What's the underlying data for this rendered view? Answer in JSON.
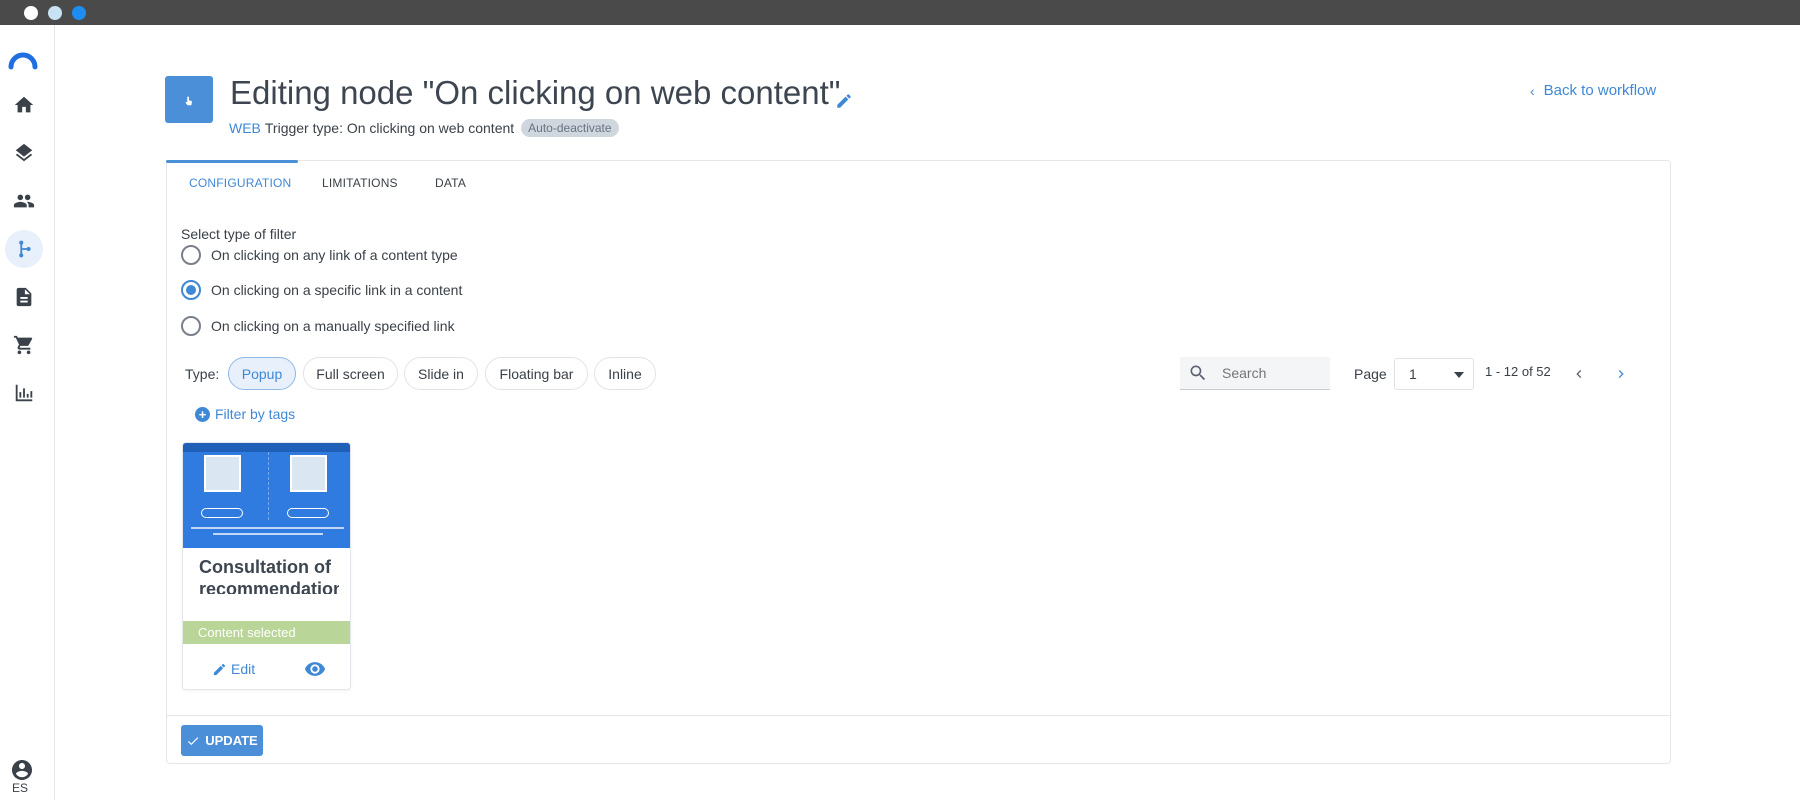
{
  "window": {
    "controls": [
      "close",
      "minimize",
      "maximize"
    ]
  },
  "sidebar": {
    "items": [
      {
        "icon": "home-icon",
        "active": false
      },
      {
        "icon": "layers-icon",
        "active": false
      },
      {
        "icon": "people-icon",
        "active": false
      },
      {
        "icon": "workflow-icon",
        "active": true
      },
      {
        "icon": "document-icon",
        "active": false
      },
      {
        "icon": "cart-icon",
        "active": false
      },
      {
        "icon": "bar-chart-icon",
        "active": false
      }
    ],
    "language": "ES"
  },
  "header": {
    "title": "Editing node \"On clicking on web content\"",
    "channel": "WEB",
    "trigger_type": "Trigger type: On clicking on web content",
    "badge": "Auto-deactivate",
    "back_link": "Back to workflow"
  },
  "tabs": [
    {
      "label": "CONFIGURATION",
      "active": true
    },
    {
      "label": "LIMITATIONS",
      "active": false
    },
    {
      "label": "DATA",
      "active": false
    }
  ],
  "filter": {
    "label": "Select type of filter",
    "options": [
      {
        "label": "On clicking on any link of a content type",
        "checked": false
      },
      {
        "label": "On clicking on a specific link in a content",
        "checked": true
      },
      {
        "label": "On clicking on a manually specified link",
        "checked": false
      }
    ]
  },
  "types": {
    "label": "Type:",
    "chips": [
      {
        "label": "Popup",
        "active": true
      },
      {
        "label": "Full screen",
        "active": false
      },
      {
        "label": "Slide in",
        "active": false
      },
      {
        "label": "Floating bar",
        "active": false
      },
      {
        "label": "Inline",
        "active": false
      }
    ]
  },
  "search": {
    "placeholder": "Search",
    "value": ""
  },
  "pagination": {
    "page_label": "Page",
    "current_page": "1",
    "range": "1 - 12 of 52"
  },
  "filter_tags": "Filter by tags",
  "contents": [
    {
      "title": "Consultation of recommendations",
      "status": "Content selected",
      "edit_label": "Edit"
    }
  ],
  "update_button": "UPDATE",
  "colors": {
    "accent": "#4b8fd9",
    "link": "#3f88d6",
    "selected": "#b9d597",
    "thumb": "#2f7be0"
  }
}
